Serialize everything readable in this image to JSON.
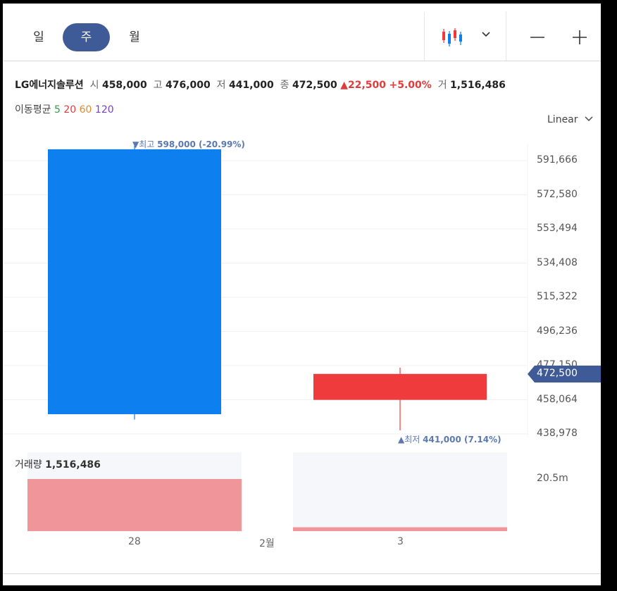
{
  "tabs": [
    {
      "label": "일",
      "active": false
    },
    {
      "label": "주",
      "active": true
    },
    {
      "label": "월",
      "active": false
    }
  ],
  "toolbar": {
    "chart_type_icon": "candlestick-icon",
    "dropdown_icon": "chevron-down-icon",
    "zoom_out_icon": "minus-icon",
    "zoom_in_icon": "plus-icon"
  },
  "quote": {
    "name": "LG에너지솔루션",
    "open_label": "시",
    "open": "458,000",
    "high_label": "고",
    "high": "476,000",
    "low_label": "저",
    "low": "441,000",
    "close_label": "종",
    "close": "472,500",
    "change": "22,500",
    "change_pct": "+5.00%",
    "volume_label": "거",
    "volume": "1,516,486"
  },
  "moving_average": {
    "label": "이동평균",
    "periods": [
      {
        "text": "5",
        "color": "#2e9e3f"
      },
      {
        "text": "20",
        "color": "#e03c3c"
      },
      {
        "text": "60",
        "color": "#e08a2c"
      },
      {
        "text": "120",
        "color": "#7a3fc9"
      }
    ]
  },
  "scale": {
    "label": "Linear"
  },
  "colors": {
    "up": "#ef3b3b",
    "down": "#0e7fef",
    "volume_up": "#f0969b",
    "label_bg": "#3e5a97",
    "accent": "#3e5a97"
  },
  "markers": {
    "high_text": "▼최고",
    "high_value": "598,000 (-20.99%)",
    "low_text": "▲최저",
    "low_value": "441,000 (7.14%)"
  },
  "current_price_label": "472,500",
  "volume_title": {
    "label": "거래량",
    "value": "1,516,486"
  },
  "chart_data": {
    "type": "candlestick",
    "x": [
      "28",
      "3"
    ],
    "candles": [
      {
        "x": "28",
        "open": 598000,
        "high": 600000,
        "low": 447000,
        "close": 450000
      },
      {
        "x": "3",
        "open": 458000,
        "high": 476000,
        "low": 441000,
        "close": 472500
      }
    ],
    "y_ticks": [
      "591,666",
      "572,580",
      "553,494",
      "534,408",
      "515,322",
      "496,236",
      "477,150",
      "458,064",
      "438,978"
    ],
    "y_tick_values": [
      591666,
      572580,
      553494,
      534408,
      515322,
      496236,
      477150,
      458064,
      438978
    ],
    "x_labels": [
      "28",
      "2월",
      "3"
    ],
    "volume": {
      "values": [
        20500000,
        1516486
      ],
      "tick": "20.5m",
      "max": 20500000
    },
    "grid": true
  }
}
